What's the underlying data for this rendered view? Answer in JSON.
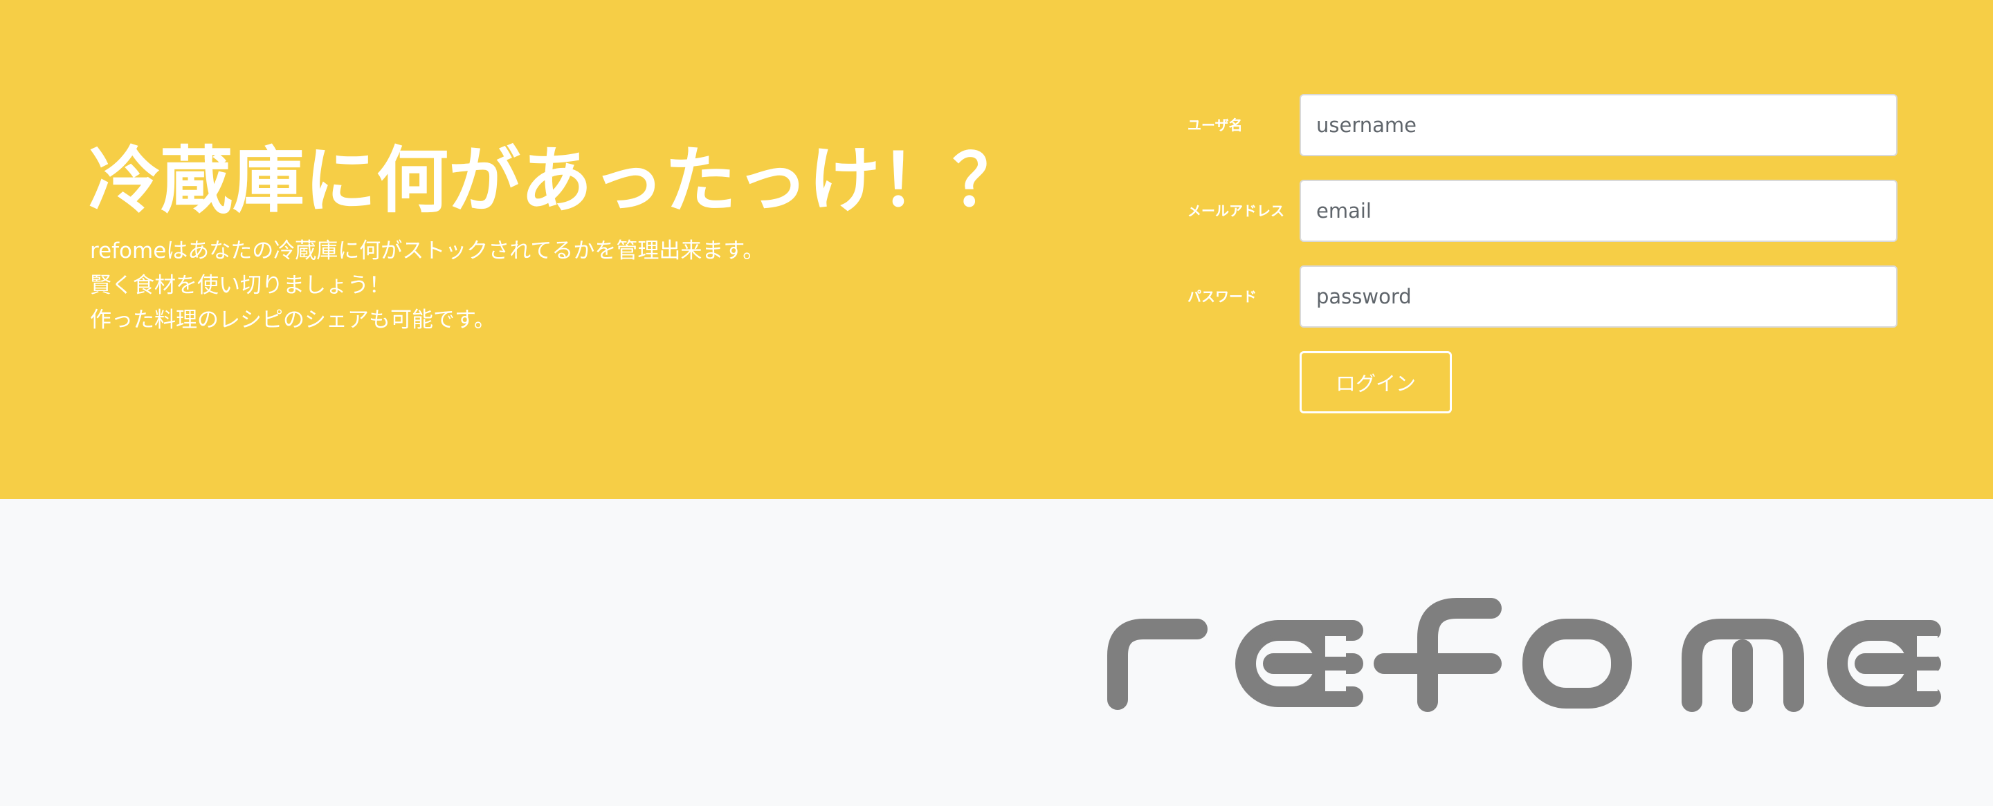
{
  "hero": {
    "headline": "冷蔵庫に何があったっけ！？",
    "description": [
      "refomeはあなたの冷蔵庫に何がストックされてるかを管理出来ます。",
      "賢く食材を使い切りましょう！",
      "作った料理のレシピのシェアも可能です。"
    ]
  },
  "login_form": {
    "username_label": "ユーザ名",
    "username_placeholder": "username",
    "email_label": "メールアドレス",
    "email_placeholder": "email",
    "password_label": "パスワード",
    "password_placeholder": "password",
    "submit_label": "ログイン"
  },
  "brand": {
    "logo_text": "refome"
  },
  "colors": {
    "hero_background": "#f6ce46",
    "page_background": "#f8f9fa",
    "logo": "#7f7f7f"
  }
}
